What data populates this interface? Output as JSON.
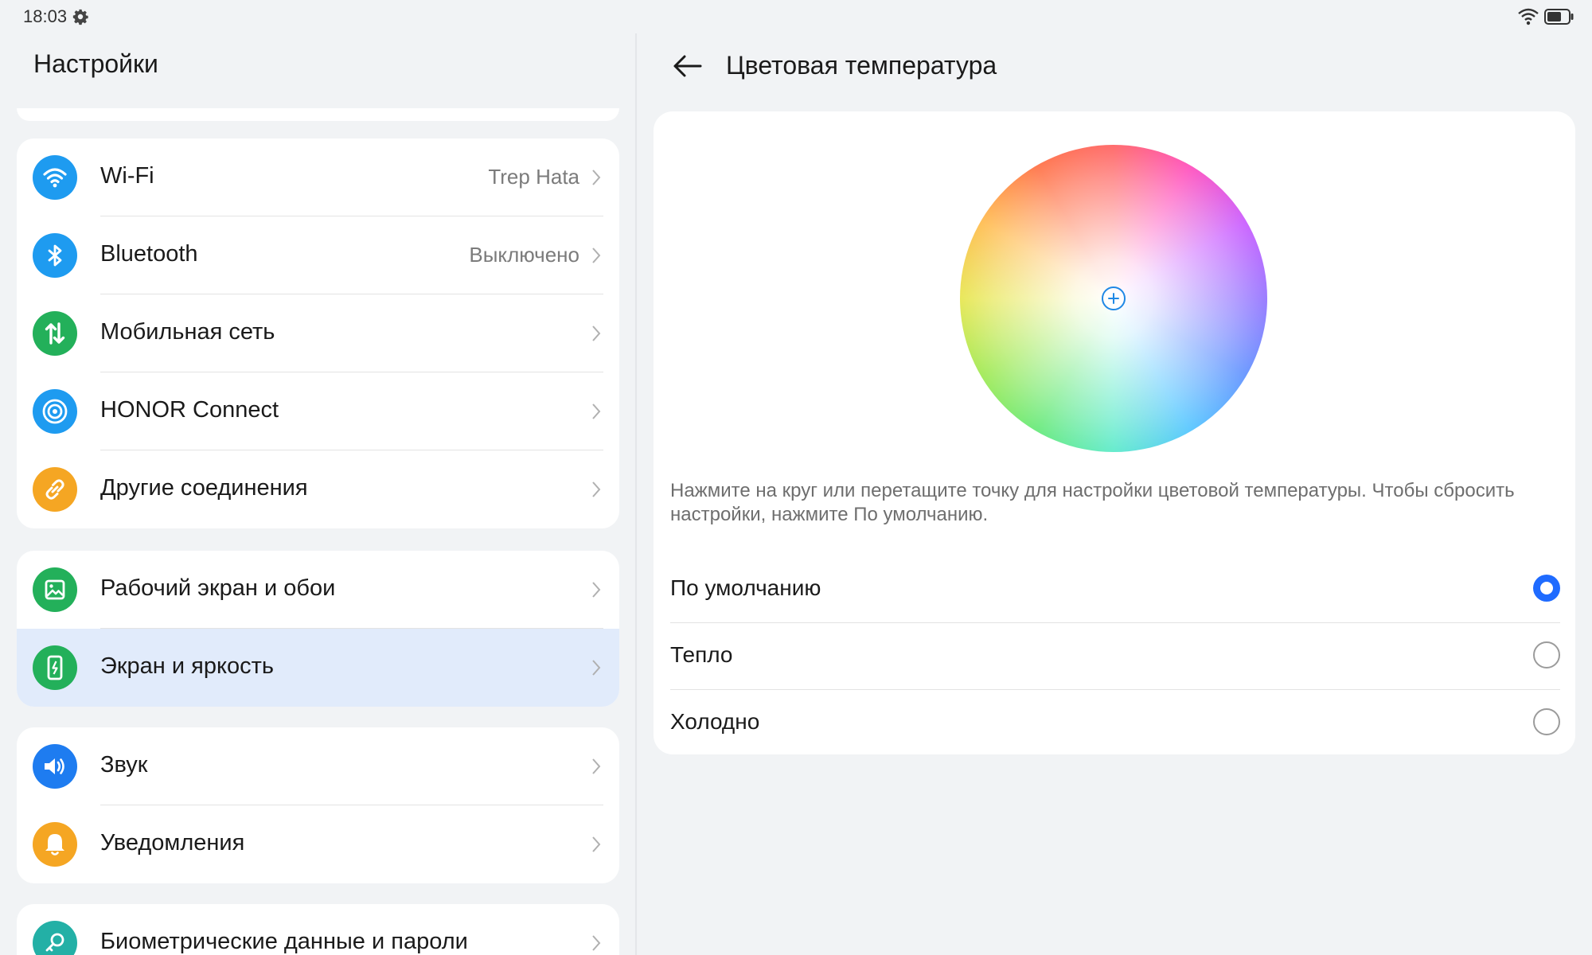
{
  "status_bar": {
    "time": "18:03",
    "icons": [
      "gear-icon",
      "wifi-icon",
      "battery-icon"
    ]
  },
  "left_pane": {
    "title": "Настройки",
    "groups": [
      [
        {
          "label": "Wi-Fi",
          "value": "Trep Hata",
          "icon": "wifi-icon",
          "color": "#1e9bf0"
        },
        {
          "label": "Bluetooth",
          "value": "Выключено",
          "icon": "bluetooth-icon",
          "color": "#1e9bf0"
        },
        {
          "label": "Мобильная сеть",
          "value": "",
          "icon": "mobile-data-icon",
          "color": "#23b05a"
        },
        {
          "label": "HONOR Connect",
          "value": "",
          "icon": "honor-connect-icon",
          "color": "#1e9bf0"
        },
        {
          "label": "Другие соединения",
          "value": "",
          "icon": "link-icon",
          "color": "#f5a623"
        }
      ],
      [
        {
          "label": "Рабочий экран и обои",
          "value": "",
          "icon": "wallpaper-icon",
          "color": "#23b05a"
        },
        {
          "label": "Экран и яркость",
          "value": "",
          "icon": "display-icon",
          "color": "#23b05a",
          "selected": true
        }
      ],
      [
        {
          "label": "Звук",
          "value": "",
          "icon": "sound-icon",
          "color": "#1e7cf0"
        },
        {
          "label": "Уведомления",
          "value": "",
          "icon": "notifications-icon",
          "color": "#f5a623"
        }
      ],
      [
        {
          "label": "Биометрические данные и пароли",
          "value": "",
          "icon": "key-icon",
          "color": "#23b0a6"
        }
      ]
    ]
  },
  "right_pane": {
    "title": "Цветовая температура",
    "hint": "Нажмите на круг или перетащите точку для настройки цветовой температуры. Чтобы сбросить настройки, нажмите По умолчанию.",
    "options": [
      {
        "label": "По умолчанию",
        "checked": true
      },
      {
        "label": "Тепло",
        "checked": false
      },
      {
        "label": "Холодно",
        "checked": false
      }
    ],
    "accent_color": "#1f6bff"
  }
}
